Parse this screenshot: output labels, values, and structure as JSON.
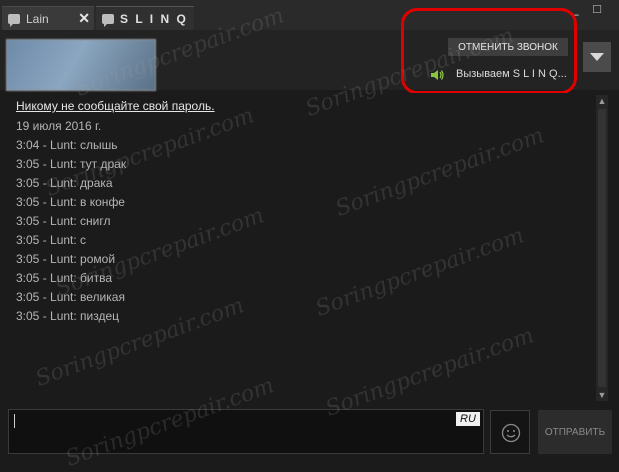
{
  "tabs": [
    {
      "label": "Lain"
    },
    {
      "label": "S L I N Q"
    }
  ],
  "window_controls": {
    "minimize": "_",
    "maximize": "□"
  },
  "call": {
    "cancel_label": "ОТМЕНИТЬ ЗВОНОК",
    "status": "Вызываем S L I N Q..."
  },
  "messages": {
    "warning": "Никому не сообщайте свой пароль.",
    "date": "19 июля 2016 г.",
    "lines": [
      "3:04 - Lunt: слышь",
      "3:05 - Lunt: тут драк",
      "3:05 - Lunt: драка",
      "3:05 - Lunt: в конфе",
      "3:05 - Lunt: снигл",
      "3:05 - Lunt: с",
      "3:05 - Lunt: ромой",
      "3:05 - Lunt: битва",
      "3:05 - Lunt: великая",
      "3:05 - Lunt: пиздец"
    ]
  },
  "input": {
    "language": "RU"
  },
  "send_label": "ОТПРАВИТЬ",
  "watermark": "Soringpcrepair.com",
  "colors": {
    "highlight": "#e00000",
    "speaker": "#8bc53f"
  }
}
